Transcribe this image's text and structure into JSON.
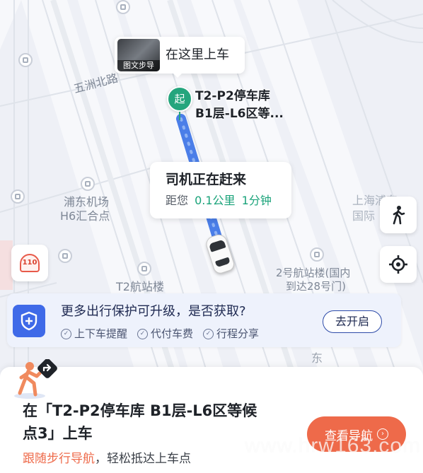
{
  "map": {
    "labels": {
      "road_wuzhou": "五洲北路",
      "poi_pudong": "浦东机场",
      "poi_h6": "H6汇合点",
      "poi_t2": "T2航站楼",
      "poi_shanghai1": "上海浦东",
      "poi_shanghai2": "国际",
      "poi_gate2_line1": "2号航站楼(国内",
      "poi_gate2_line2": "到达28号门)",
      "road_east": "东"
    }
  },
  "pickup_bubble": {
    "thumb_label": "图文步导",
    "text": "在这里上车"
  },
  "start_marker": {
    "badge": "起",
    "line1": "T2-P2停车库",
    "line2": "B1层-L6区等..."
  },
  "driver_card": {
    "title": "司机正在赶来",
    "prefix": "距您",
    "distance": "0.1公里",
    "eta": "1分钟"
  },
  "police_button": {
    "label": "110"
  },
  "protect_banner": {
    "title": "更多出行保护可升级，是否获取?",
    "features": [
      "上下车提醒",
      "代付车费",
      "行程分享"
    ],
    "button": "去开启"
  },
  "bottom_sheet": {
    "title_line1": "在「T2-P2停车库 B1层-L6区等候",
    "title_line2": "点3」上车",
    "sub_highlight": "跟随步行导航",
    "sub_rest": "，轻松抵达上车点",
    "nav_button": "查看导航"
  },
  "watermark": "www.hrw163.com",
  "colors": {
    "route": "#4b7ee8",
    "accent_green": "#1aa37a",
    "accent_orange": "#ee6a4a",
    "brand_blue": "#3f6ae8"
  }
}
